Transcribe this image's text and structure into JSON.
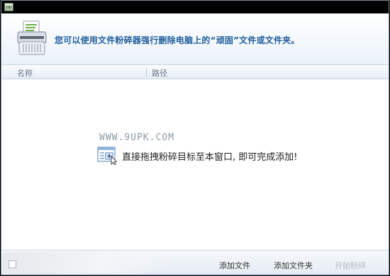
{
  "banner": {
    "message": "您可以使用文件粉碎器强行删除电脑上的“顽固”文件或文件夹。"
  },
  "columns": {
    "name": "名称",
    "path": "路径"
  },
  "list": {
    "watermark": "WWW.9UPK.COM",
    "drop_hint": "直接拖拽粉碎目标至本窗口, 即可完成添加!"
  },
  "footer": {
    "add_file_label": "添加文件",
    "add_folder_label": "添加文件夹",
    "start_shred_label": "开始粉碎",
    "start_shred_enabled": false
  },
  "icons": {
    "app": "shredder-app-icon",
    "banner": "shredder-icon",
    "drop": "drag-add-icon"
  }
}
